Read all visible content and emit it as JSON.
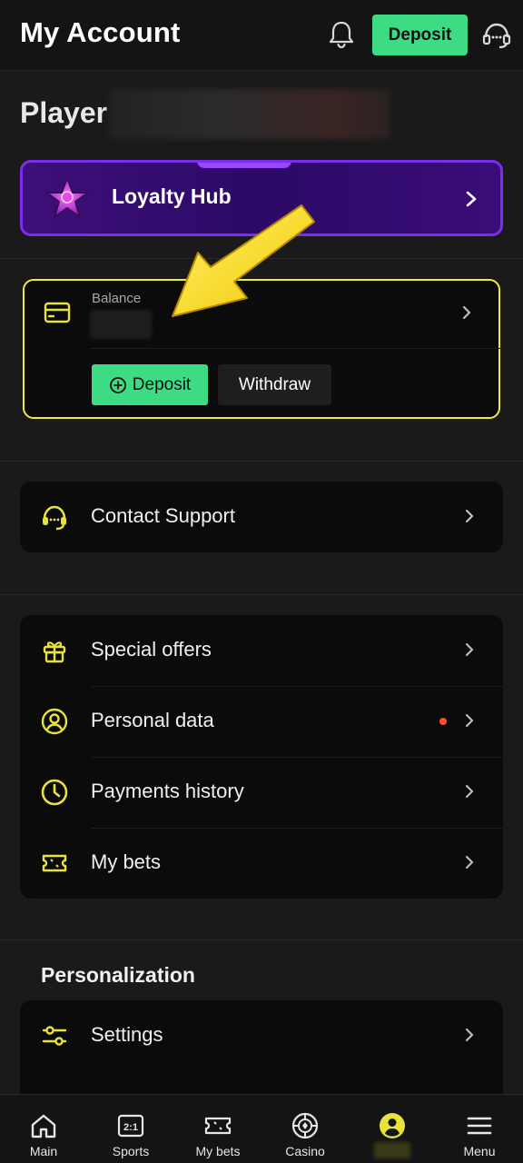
{
  "header": {
    "title": "My Account",
    "deposit_label": "Deposit",
    "icons": [
      "bell-icon",
      "headset-icon"
    ]
  },
  "profile": {
    "player_label": "Player"
  },
  "loyalty": {
    "label": "Loyalty Hub"
  },
  "balance": {
    "label": "Balance",
    "deposit_label": "Deposit",
    "withdraw_label": "Withdraw"
  },
  "support": {
    "label": "Contact Support"
  },
  "menu": {
    "items": [
      {
        "label": "Special offers",
        "icon": "gift-icon"
      },
      {
        "label": "Personal data",
        "icon": "user-circle-icon",
        "has_dot": true
      },
      {
        "label": "Payments history",
        "icon": "clock-icon"
      },
      {
        "label": "My bets",
        "icon": "ticket-icon"
      }
    ]
  },
  "personalization": {
    "title": "Personalization",
    "items": [
      {
        "label": "Settings",
        "icon": "sliders-icon"
      }
    ]
  },
  "bottom_nav": {
    "items": [
      {
        "label": "Main",
        "icon": "home-icon"
      },
      {
        "label": "Sports",
        "icon": "scoreboard-icon"
      },
      {
        "label": "My bets",
        "icon": "ticket-icon"
      },
      {
        "label": "Casino",
        "icon": "chip-icon"
      },
      {
        "label": "",
        "icon": "account-icon",
        "active": true
      },
      {
        "label": "Menu",
        "icon": "hamburger-icon"
      }
    ]
  },
  "colors": {
    "accent_green": "#3ddc84",
    "accent_yellow": "#e8e33a",
    "loyalty_purple": "#7a2cf0",
    "background": "#1a1a1a",
    "card": "#0b0b0b",
    "notification_dot": "#ff4b2b"
  }
}
